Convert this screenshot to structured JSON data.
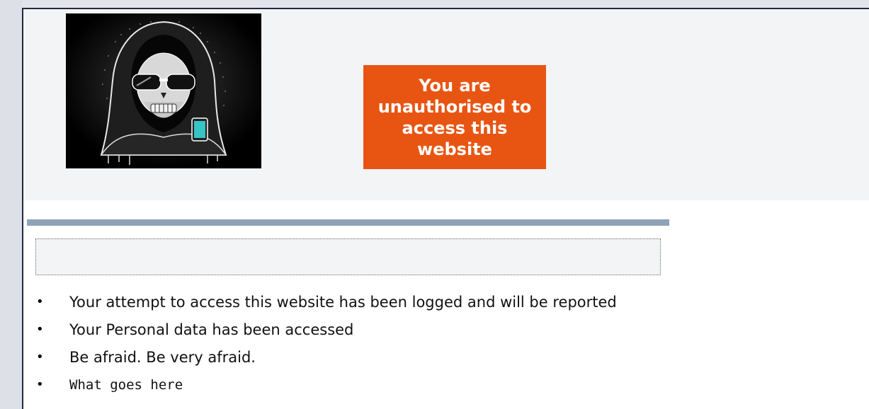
{
  "banner": {
    "text": "You are unauthorised to access this website",
    "background": "#e85512"
  },
  "image": {
    "subject": "hooded-skull-hacker-with-sunglasses-and-phone"
  },
  "divider": {
    "color": "#8fa2b8"
  },
  "notice_box": {
    "text": ""
  },
  "bullets": [
    {
      "text": "Your attempt to access this website has been logged and will be reported"
    },
    {
      "text": "Your Personal data has been accessed"
    },
    {
      "text": "Be afraid. Be very afraid."
    },
    {
      "text": "What goes here"
    }
  ]
}
